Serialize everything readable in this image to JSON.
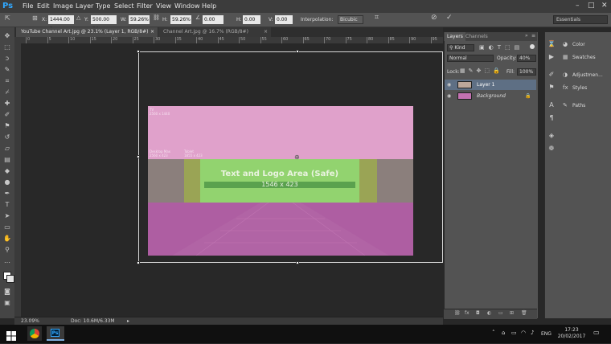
{
  "app": {
    "logo": "Ps"
  },
  "menu": [
    "File",
    "Edit",
    "Image",
    "Layer",
    "Type",
    "Select",
    "Filter",
    "View",
    "Window",
    "Help"
  ],
  "window_controls": {
    "minimize": "–",
    "maximize": "□",
    "close": "✕"
  },
  "options_bar": {
    "x_label": "X:",
    "x_value": "1444.00 p",
    "y_label": "Y:",
    "y_value": "500.00 px",
    "w_label": "W:",
    "w_value": "59.26%",
    "h_label": "H:",
    "h_value": "59.26%",
    "angle_value": "0.00",
    "hskew_label": "H:",
    "hskew_value": "0.00",
    "vskew_label": "V:",
    "vskew_value": "0.00",
    "interpolation_label": "Interpolation:",
    "interpolation_value": "Bicubic",
    "workspace": "Essentials"
  },
  "tabs": [
    {
      "label": "YouTube Channel Art.jpg @ 23.1% (Layer 1, RGB/8#)",
      "close": "×",
      "active": true
    },
    {
      "label": "Channel Art.jpg @ 16.7% (RGB/8#)",
      "close": "×",
      "active": false
    }
  ],
  "ruler_marks": [
    "0",
    "5",
    "10",
    "15",
    "20",
    "25",
    "30",
    "35",
    "40",
    "45",
    "50",
    "55",
    "60",
    "65",
    "70",
    "75",
    "80",
    "85",
    "90",
    "95"
  ],
  "artwork": {
    "tv_label": "TV",
    "tv_size": "2560 x 1440",
    "desktop_label": "Desktop Max",
    "desktop_size": "2560 x 423",
    "tablet_label": "Tablet",
    "tablet_size": "1855 x 423",
    "safe_title": "Text and Logo Area (Safe)",
    "safe_size": "1546 x 423"
  },
  "status": {
    "zoom": "23.09%",
    "doc": "Doc: 10.6M/6.33M"
  },
  "layers_panel": {
    "tab_layers": "Layers",
    "tab_channels": "Channels",
    "kind": "Kind",
    "blend_mode": "Normal",
    "opacity_label": "Opacity:",
    "opacity_value": "40%",
    "lock_label": "Lock:",
    "fill_label": "Fill:",
    "fill_value": "100%",
    "layers": [
      {
        "name": "Layer 1",
        "selected": true
      },
      {
        "name": "Background",
        "selected": false
      }
    ]
  },
  "right_panel": {
    "items": [
      {
        "label": "Color",
        "icon": "color-icon"
      },
      {
        "label": "Swatches",
        "icon": "swatches-icon"
      },
      {
        "label": "Adjustmen...",
        "icon": "adjustments-icon"
      },
      {
        "label": "Styles",
        "icon": "styles-icon"
      },
      {
        "label": "Paths",
        "icon": "paths-icon"
      }
    ]
  },
  "taskbar": {
    "language": "ENG",
    "time": "17:23",
    "date": "20/02/2017"
  }
}
